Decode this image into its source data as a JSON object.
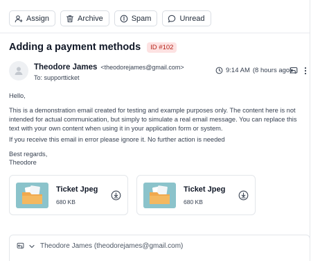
{
  "toolbar": {
    "assign_label": "Assign",
    "archive_label": "Archive",
    "spam_label": "Spam",
    "unread_label": "Unread"
  },
  "ticket": {
    "subject": "Adding a payment methods",
    "id_badge": "ID #102"
  },
  "sender": {
    "name": "Theodore James",
    "email": "<theodorejames@gmail.com>",
    "to": "To: supportticket"
  },
  "meta": {
    "time": "9:14 AM",
    "ago": "(8 hours ago)"
  },
  "body": {
    "greeting": "Hello,",
    "paragraph": "This is a demonstration email created for testing and example purposes only. The content here is not intended for actual communication, but simply to simulate a real email message. You can replace this text with your own content when using it in your application form or system.",
    "notice": "If you receive this email in error please ignore it. No further action is needed",
    "signoff": "Best regards,",
    "signature": "Theodore"
  },
  "attachments": [
    {
      "name": "Ticket Jpeg",
      "size": "680 KB",
      "icon": "folder-icon"
    },
    {
      "name": "Ticket Jpeg",
      "size": "680 KB",
      "icon": "folder-icon"
    }
  ],
  "reply": {
    "recipient": "Theodore James (theodorejames@gmail.com)"
  },
  "colors": {
    "badge_bg": "#fde2e2",
    "badge_text": "#b42318",
    "thumbnail_bg": "#8bc3cb",
    "folder": "#f4b860"
  }
}
